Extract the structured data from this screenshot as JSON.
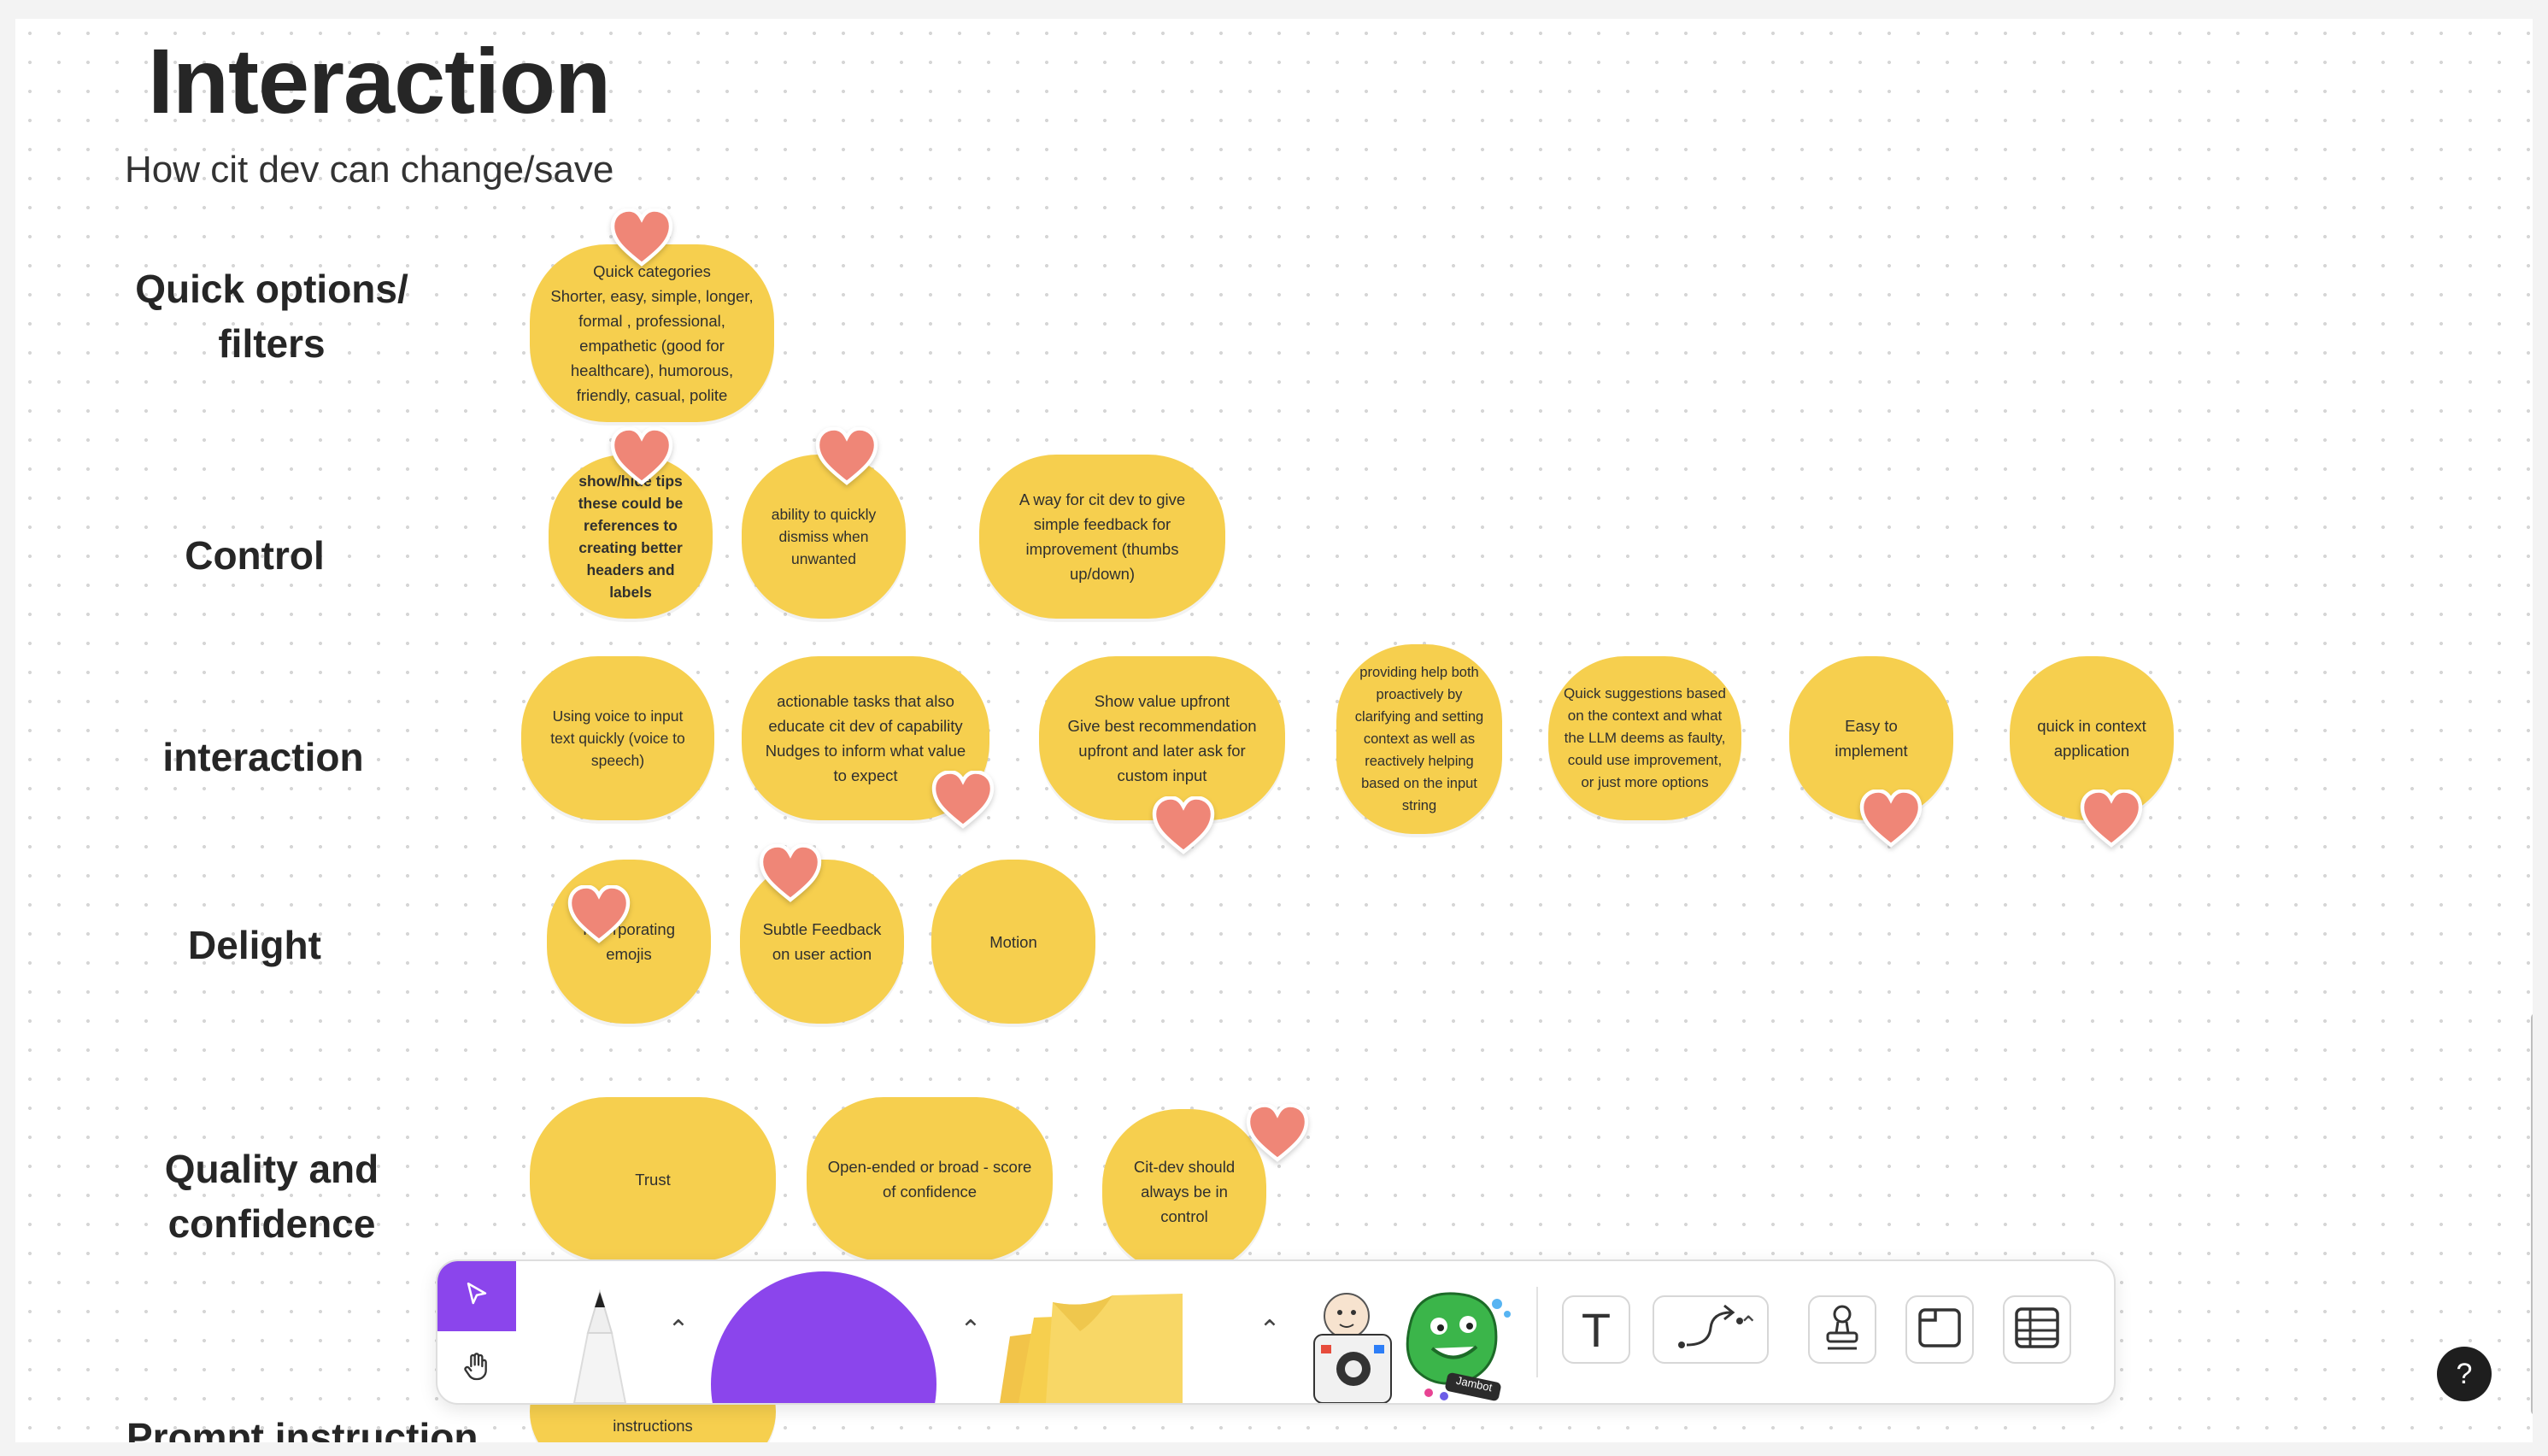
{
  "page": {
    "title": "Interaction",
    "subtitle": "How cit dev can change/save"
  },
  "rows": {
    "quick_options": "Quick options/\nfilters",
    "control": "Control",
    "interaction": "interaction",
    "delight": "Delight",
    "quality": "Quality and\nconfidence",
    "prompt": "Prompt instruction"
  },
  "stickies": {
    "quick_categories": "Quick categories\nShorter, easy, simple, longer, formal , professional, empathetic (good for healthcare), humorous, friendly, casual, polite",
    "show_hide_tips": "show/hide tips\nthese could be references to creating better headers and labels",
    "dismiss": "ability to quickly dismiss when unwanted",
    "feedback": "A way for cit dev to give simple feedback for improvement (thumbs up/down)",
    "voice": "Using voice to input text quickly (voice to speech)",
    "actionable": "actionable tasks that also educate cit dev of capability\nNudges to inform what value to expect",
    "value_upfront": "Show value upfront\nGive best recommendation upfront and later ask for custom input",
    "help": "providing help both proactively by clarifying and setting context as well as reactively helping based on the input string",
    "quick_suggestions": "Quick suggestions based on the context and what the LLM deems as faulty, could use improvement, or just more options",
    "easy": "Easy to implement",
    "in_context": "quick in context application",
    "emojis": "Incorporating emojis",
    "subtle_feedback": "Subtle Feedback on user action",
    "motion": "Motion",
    "trust": "Trust",
    "open_ended": "Open-ended or broad - score of confidence",
    "control_flag": "Cit-dev should always be in control",
    "instructions": "instructions"
  },
  "toolbar": {
    "items": [
      "select-tool",
      "hand-tool",
      "pen-tool",
      "shape-tool",
      "sticky-note-tool",
      "stickers-tool",
      "text-tool",
      "connector-tool",
      "stamp-tool",
      "section-tool",
      "table-tool"
    ],
    "sticker_text": "Jambot",
    "text_tool_glyph": "T"
  },
  "help": {
    "label": "?"
  },
  "colors": {
    "sticky": "#f6cf4e",
    "heart": "#ef8677",
    "accent": "#8b45ec",
    "shape": "#8b45ec"
  }
}
